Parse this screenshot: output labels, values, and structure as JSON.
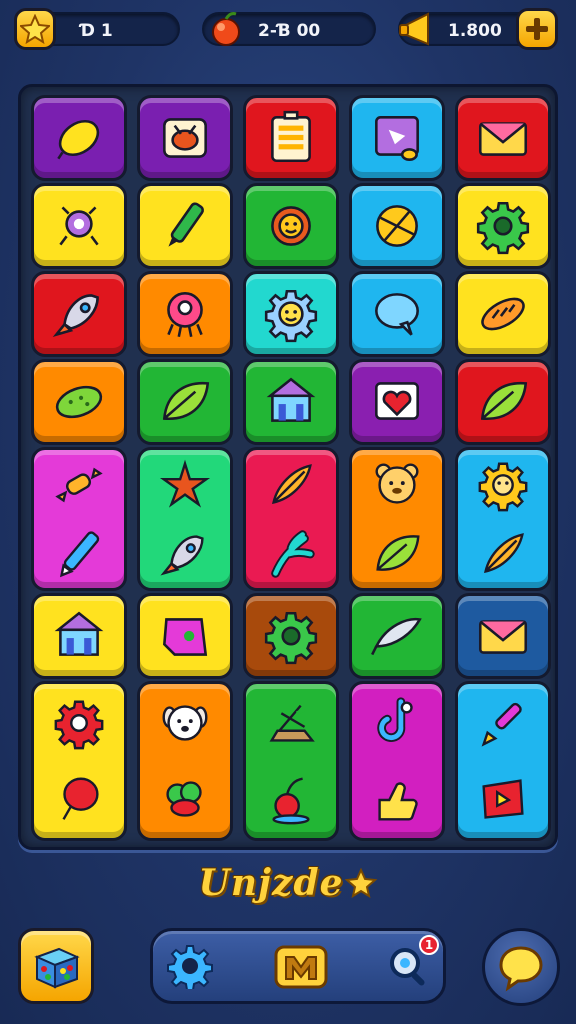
{
  "topbar": {
    "stars": {
      "icon": "star-icon",
      "value": "Ɗ 1"
    },
    "gems": {
      "icon": "fruit-icon",
      "value": "2-Ɓ  00"
    },
    "coins": {
      "icon": "horn-icon",
      "value": "1.800"
    },
    "add": {
      "icon": "plus-icon"
    }
  },
  "board": {
    "rows": 7,
    "columns": 5,
    "tiles": [
      {
        "icons": [
          "lemon-icon"
        ],
        "color": "#7a1fb0"
      },
      {
        "icons": [
          "drum-icon"
        ],
        "color": "#7a1fb0"
      },
      {
        "icons": [
          "battery-icon"
        ],
        "color": "#e0161e"
      },
      {
        "icons": [
          "picture-icon"
        ],
        "color": "#1fb6ef"
      },
      {
        "icons": [
          "envelope-icon"
        ],
        "color": "#e0161e"
      },
      {
        "icons": [
          "bug-icon"
        ],
        "color": "#ffe21f"
      },
      {
        "icons": [
          "pencil-icon"
        ],
        "color": "#ffe21f"
      },
      {
        "icons": [
          "sun-gear-icon"
        ],
        "color": "#22b635"
      },
      {
        "icons": [
          "ball-icon"
        ],
        "color": "#1fb6ef"
      },
      {
        "icons": [
          "gear-icon"
        ],
        "color": "#ffe21f"
      },
      {
        "icons": [
          "rocket-icon"
        ],
        "color": "#e0161e"
      },
      {
        "icons": [
          "octopus-icon"
        ],
        "color": "#ff8a00"
      },
      {
        "icons": [
          "sun-face-icon"
        ],
        "color": "#22d8cf"
      },
      {
        "icons": [
          "speech-bubble-icon"
        ],
        "color": "#1fb6ef"
      },
      {
        "icons": [
          "bread-icon"
        ],
        "color": "#ffe21f"
      },
      {
        "icons": [
          "pickle-icon"
        ],
        "color": "#ff8a00"
      },
      {
        "icons": [
          "leaf-icon"
        ],
        "color": "#22b635"
      },
      {
        "icons": [
          "house-icon"
        ],
        "color": "#22b635"
      },
      {
        "icons": [
          "heart-card-icon"
        ],
        "color": "#8a1fb0"
      },
      {
        "icons": [
          "leaf-icon"
        ],
        "color": "#e0161e"
      },
      {
        "icons": [
          "candy-icon",
          "crayon-icon"
        ],
        "color": "#e43ad8"
      },
      {
        "icons": [
          "starfish-icon",
          "rocket-icon"
        ],
        "color": "#22d87a"
      },
      {
        "icons": [
          "feather-icon",
          "claw-icon"
        ],
        "color": "#ea1a52"
      },
      {
        "icons": [
          "bear-face-icon",
          "leaf-icon"
        ],
        "color": "#ff8a00"
      },
      {
        "icons": [
          "cookie-face-icon",
          "feather-icon"
        ],
        "color": "#1fb6ef"
      },
      {
        "icons": [
          "house-icon"
        ],
        "color": "#ffe21f"
      },
      {
        "icons": [
          "tag-icon"
        ],
        "color": "#ffe21f"
      },
      {
        "icons": [
          "gear-icon"
        ],
        "color": "#a84a0c"
      },
      {
        "icons": [
          "wing-icon"
        ],
        "color": "#22b635"
      },
      {
        "icons": [
          "envelope-icon"
        ],
        "color": "#1e5aa0"
      },
      {
        "icons": [
          "flower-icon",
          "balloon-icon"
        ],
        "color": "#ffe21f"
      },
      {
        "icons": [
          "dog-face-icon",
          "broccoli-icon"
        ],
        "color": "#ff8a00"
      },
      {
        "icons": [
          "boat-icon",
          "cherry-icon"
        ],
        "color": "#22b635"
      },
      {
        "icons": [
          "hook-icon",
          "thumb-icon"
        ],
        "color": "#d21fc0"
      },
      {
        "icons": [
          "paintbrush-icon",
          "flag-icon"
        ],
        "color": "#1fb6ef"
      }
    ]
  },
  "title": "Unjzde",
  "title_icon": "star-icon",
  "bottom": {
    "shop": {
      "icon": "gift-box-icon"
    },
    "nav": [
      {
        "icon": "gear-icon"
      },
      {
        "icon": "m-badge-icon"
      },
      {
        "icon": "magnifier-gear-icon",
        "badge": "1"
      }
    ],
    "chat": {
      "icon": "chat-bubble-icon"
    }
  },
  "colors": {
    "background": "#1f3466",
    "accent": "#ffd23c"
  }
}
